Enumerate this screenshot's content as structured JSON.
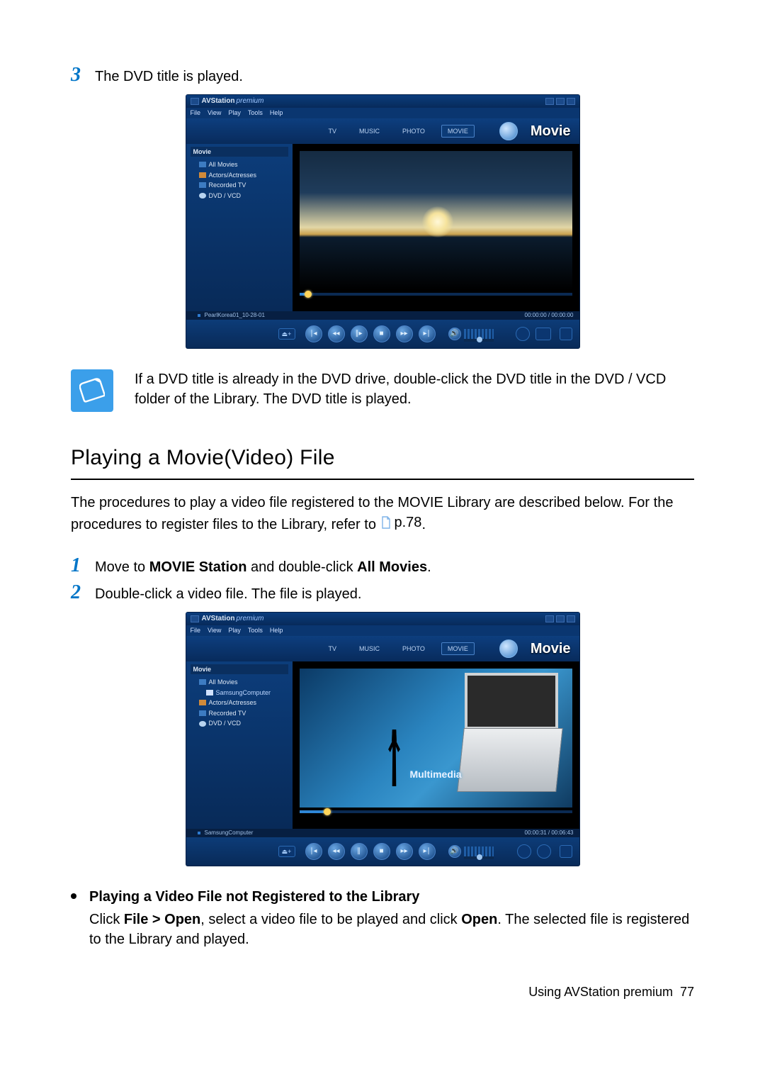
{
  "step3": {
    "num": "3",
    "text": "The DVD title is played."
  },
  "shot1": {
    "title_app": "AVStation",
    "title_suffix": "premium",
    "menu": [
      "File",
      "View",
      "Play",
      "Tools",
      "Help"
    ],
    "tabs": {
      "tv": "TV",
      "music": "MUSIC",
      "photo": "PHOTO",
      "movie": "MOVIE"
    },
    "big_label": "Movie",
    "side_header": "Movie",
    "side_items": {
      "all": "All Movies",
      "actors": "Actors/Actresses",
      "recorded": "Recorded TV",
      "dvd": "DVD / VCD"
    },
    "info_name": "PearlKorea01_10-28-01",
    "info_time": "00:00:00 / 00:00:00",
    "seek_percent": 2
  },
  "note": "If a DVD title is already in the DVD drive, double-click the DVD title in the DVD / VCD folder of the Library. The DVD title is played.",
  "heading": "Playing a Movie(Video) File",
  "intro_a": "The procedures to play a video file registered to the MOVIE Library are described below. For the procedures to register files to the Library, refer to ",
  "intro_ref": "p.78",
  "intro_b": ".",
  "step1": {
    "num": "1",
    "pre": "Move to ",
    "b1": "MOVIE Station",
    "mid": " and double-click ",
    "b2": "All Movies",
    "post": "."
  },
  "step2": {
    "num": "2",
    "text": "Double-click a video file. The file is played."
  },
  "shot2": {
    "title_app": "AVStation",
    "title_suffix": "premium",
    "menu": [
      "File",
      "View",
      "Play",
      "Tools",
      "Help"
    ],
    "tabs": {
      "tv": "TV",
      "music": "MUSIC",
      "photo": "PHOTO",
      "movie": "MOVIE"
    },
    "big_label": "Movie",
    "side_header": "Movie",
    "side_items": {
      "all": "All Movies",
      "sub": "SamsungComputer",
      "actors": "Actors/Actresses",
      "recorded": "Recorded TV",
      "dvd": "DVD / VCD"
    },
    "overlay_text": "Multimedia",
    "info_name": "SamsungComputer",
    "info_time": "00:00:31 / 00:06:43",
    "seek_percent": 9
  },
  "bullet": {
    "title": "Playing a Video File not Registered to the Library",
    "body_a": "Click ",
    "b1": "File > Open",
    "body_b": ", select a video file to be played and click ",
    "b2": "Open",
    "body_c": ". The selected file is registered to the Library and played."
  },
  "footer_a": "Using AVStation premium",
  "footer_b": "77"
}
